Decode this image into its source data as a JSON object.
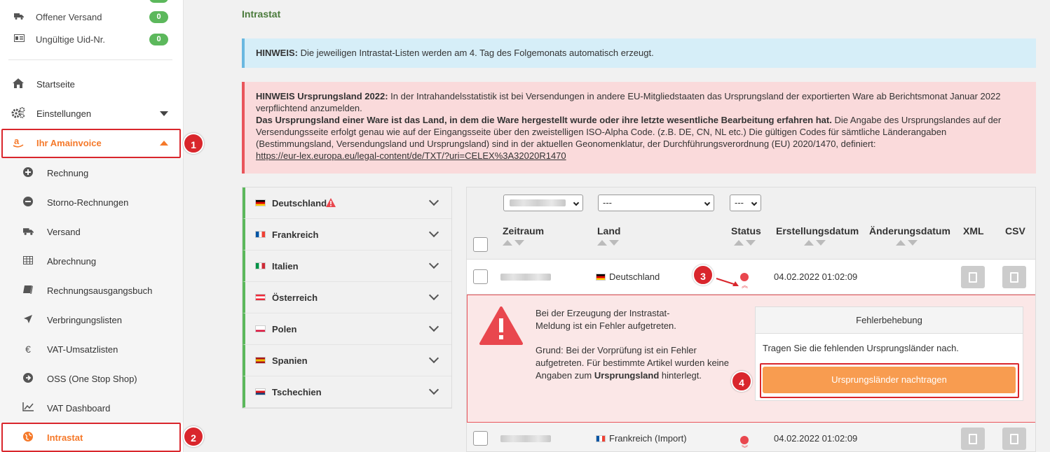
{
  "watermark": "amainvoice",
  "sidebar": {
    "top_items": [
      {
        "icon": "truck-icon",
        "label": "Offener Versand",
        "count": "0"
      },
      {
        "icon": "id-card-icon",
        "label": "Ungültige Uid-Nr.",
        "count": "0"
      }
    ],
    "nav": [
      {
        "icon": "home-icon",
        "label": "Startseite"
      },
      {
        "icon": "cogs-icon",
        "label": "Einstellungen"
      },
      {
        "icon": "amazon-icon",
        "label": "Ihr Amainvoice"
      }
    ],
    "sub_items": [
      {
        "icon": "plus-circle-icon",
        "label": "Rechnung"
      },
      {
        "icon": "minus-circle-icon",
        "label": "Storno-Rechnungen"
      },
      {
        "icon": "truck-icon",
        "label": "Versand"
      },
      {
        "icon": "table-icon",
        "label": "Abrechnung"
      },
      {
        "icon": "book-icon",
        "label": "Rechnungsausgangsbuch"
      },
      {
        "icon": "plane-icon",
        "label": "Verbringungslisten"
      },
      {
        "icon": "euro-icon",
        "label": "VAT-Umsatzlisten"
      },
      {
        "icon": "arrow-circle-icon",
        "label": "OSS (One Stop Shop)"
      },
      {
        "icon": "chart-line-icon",
        "label": "VAT Dashboard"
      },
      {
        "icon": "globe-icon",
        "label": "Intrastat"
      }
    ]
  },
  "markers": [
    "1",
    "2",
    "3",
    "4"
  ],
  "page": {
    "title": "Intrastat",
    "info_bold": "HINWEIS:",
    "info_text": " Die jeweiligen Intrastat-Listen werden am 4. Tag des Folgemonats automatisch erzeugt.",
    "danger_bold1": "HINWEIS Ursprungsland 2022:",
    "danger_text1": " In der Intrahandelsstatistik ist bei Versendungen in andere EU-Mitgliedstaaten das Ursprungsland der exportierten Ware ab Berichtsmonat Januar 2022 verpflichtend anzumelden.",
    "danger_bold2": "Das Ursprungsland einer Ware ist das Land, in dem die Ware hergestellt wurde oder ihre letzte wesentliche Bearbeitung erfahren hat.",
    "danger_text2": " Die Angabe des Ursprungslandes auf der Versendungsseite erfolgt genau wie auf der Eingangsseite über den zweistelligen ISO-Alpha Code. (z.B. DE, CN, NL etc.) Die gültigen Codes für sämtliche Länderangaben (Bestimmungsland, Versendungsland und Ursprungsland) sind in der aktuellen Geonomenklatur, der Durchführungsverordnung (EU) 2020/1470, definiert:",
    "danger_link": "https://eur-lex.europa.eu/legal-content/de/TXT/?uri=CELEX%3A32020R1470"
  },
  "countries": [
    {
      "name": "Deutschland",
      "flag": [
        "#000000",
        "#dd0000",
        "#ffce00"
      ],
      "warning": true
    },
    {
      "name": "Frankreich",
      "flag": [
        "#0055a4",
        "#ffffff",
        "#ef4135"
      ],
      "vertical": true
    },
    {
      "name": "Italien",
      "flag": [
        "#009246",
        "#ffffff",
        "#ce2b37"
      ],
      "vertical": true
    },
    {
      "name": "Österreich",
      "flag": [
        "#ed2939",
        "#ffffff",
        "#ed2939"
      ]
    },
    {
      "name": "Polen",
      "flag": [
        "#ffffff",
        "#ffffff",
        "#dc143c"
      ]
    },
    {
      "name": "Spanien",
      "flag": [
        "#aa151b",
        "#f1bf00",
        "#aa151b"
      ]
    },
    {
      "name": "Tschechien",
      "flag": [
        "#ffffff",
        "#d7141a",
        "#11457e"
      ]
    }
  ],
  "filters": {
    "land_value": "---",
    "status_value": "---"
  },
  "table": {
    "headers": [
      "Zeitraum",
      "Land",
      "Status",
      "Erstellungsdatum",
      "Änderungsdatum",
      "XML",
      "CSV"
    ],
    "rows": [
      {
        "land": "Deutschland",
        "created": "04.02.2022 01:02:09"
      },
      {
        "land": "Frankreich (Import)",
        "created": "04.02.2022 01:02:09"
      }
    ]
  },
  "error": {
    "line1": "Bei der Erzeugung der Instrastat-Meldung ist ein Fehler aufgetreten.",
    "line2": "Grund: Bei der Vorprüfung ist ein Fehler aufgetreten. Für bestimmte Artikel wurden keine Angaben zum ",
    "line2_bold": "Ursprungsland",
    "line2_end": " hinterlegt.",
    "fix_header": "Fehlerbehebung",
    "fix_text": "Tragen Sie die fehlenden Ursprungsländer nach.",
    "fix_button": "Ursprungsländer nachtragen"
  },
  "colors": {
    "accent": "#f5792a",
    "green": "#5cb85c",
    "danger": "#d9262c"
  }
}
